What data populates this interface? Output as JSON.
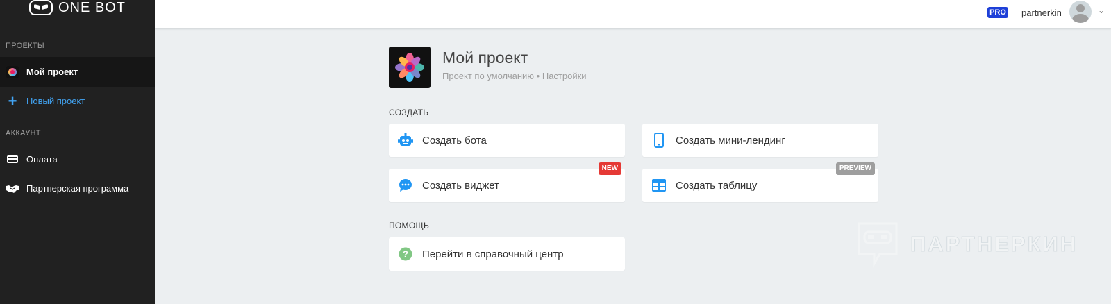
{
  "app": {
    "name": "ONE BOT"
  },
  "sidebar": {
    "projects_label": "ПРОЕКТЫ",
    "current_project": "Мой проект",
    "new_project": "Новый проект",
    "account_label": "АККАУНТ",
    "payment": "Оплата",
    "partner_program": "Партнерская программа"
  },
  "header": {
    "plan_badge": "PRO",
    "username": "partnerkin"
  },
  "project": {
    "title": "Мой проект",
    "subtitle": "Проект по умолчанию • Настройки"
  },
  "create": {
    "heading": "СОЗДАТЬ",
    "bot": "Создать бота",
    "landing": "Создать мини-лендинг",
    "widget": "Создать виджет",
    "widget_badge": "NEW",
    "table": "Создать таблицу",
    "table_badge": "PREVIEW"
  },
  "help": {
    "heading": "ПОМОЩЬ",
    "center": "Перейти в справочный центр"
  },
  "watermark": {
    "text": "ПАРТНЕРКИН"
  },
  "colors": {
    "accent_blue": "#2196f3",
    "badge_new": "#e53935",
    "badge_preview": "#9e9e9e",
    "pro_badge": "#1e40d8",
    "help_green": "#81c784"
  }
}
